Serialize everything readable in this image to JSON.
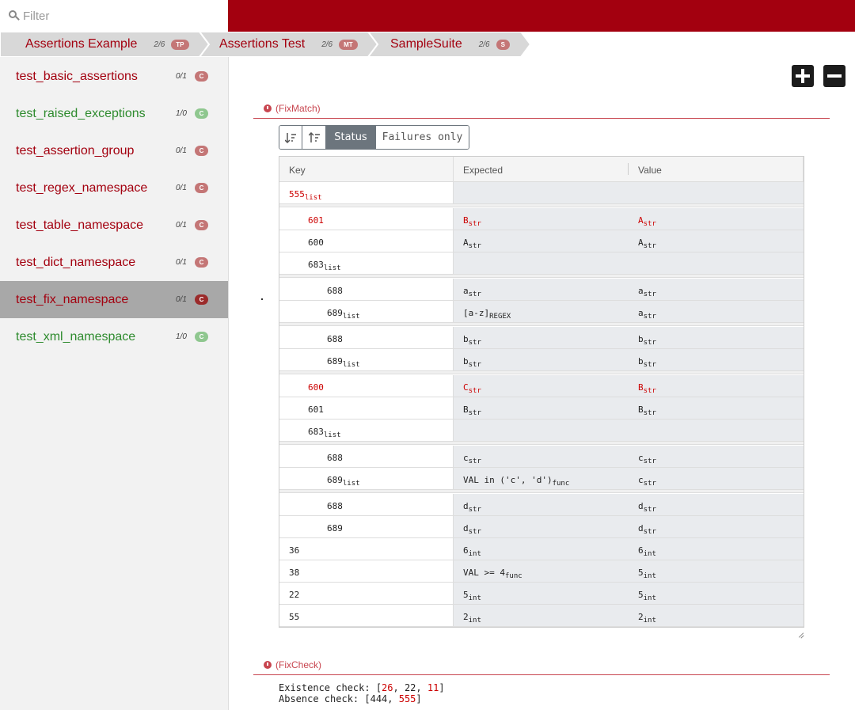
{
  "filter": {
    "placeholder": "Filter"
  },
  "breadcrumbs": [
    {
      "label": "Assertions Example",
      "count": "2/6",
      "badge": "TP"
    },
    {
      "label": "Assertions Test",
      "count": "2/6",
      "badge": "MT"
    },
    {
      "label": "SampleSuite",
      "count": "2/6",
      "badge": "S"
    }
  ],
  "sidebar": {
    "items": [
      {
        "name": "test_basic_assertions",
        "count": "0/1",
        "badge": "C",
        "status": "fail"
      },
      {
        "name": "test_raised_exceptions",
        "count": "1/0",
        "badge": "C",
        "status": "pass"
      },
      {
        "name": "test_assertion_group",
        "count": "0/1",
        "badge": "C",
        "status": "fail"
      },
      {
        "name": "test_regex_namespace",
        "count": "0/1",
        "badge": "C",
        "status": "fail"
      },
      {
        "name": "test_table_namespace",
        "count": "0/1",
        "badge": "C",
        "status": "fail"
      },
      {
        "name": "test_dict_namespace",
        "count": "0/1",
        "badge": "C",
        "status": "fail"
      },
      {
        "name": "test_fix_namespace",
        "count": "0/1",
        "badge": "C",
        "status": "active"
      },
      {
        "name": "test_xml_namespace",
        "count": "1/0",
        "badge": "C",
        "status": "pass"
      }
    ]
  },
  "toolbar": {
    "expand_icon": "plus-icon",
    "collapse_icon": "minus-icon"
  },
  "fixmatch": {
    "title": "(FixMatch)",
    "buttons": {
      "sort_desc_icon": "sort-descending-icon",
      "sort_asc_icon": "sort-ascending-icon",
      "status": "Status",
      "failures_only": "Failures only"
    },
    "columns": {
      "key": "Key",
      "expected": "Expected",
      "value": "Value"
    },
    "rows": [
      {
        "key": "555",
        "key_type": "list",
        "expected": "",
        "expected_type": "",
        "value": "",
        "value_type": "",
        "indent": 0,
        "failed": true
      },
      {
        "key": "601",
        "key_type": "",
        "expected": "B",
        "expected_type": "str",
        "value": "A",
        "value_type": "str",
        "indent": 1,
        "failed": true
      },
      {
        "key": "600",
        "key_type": "",
        "expected": "A",
        "expected_type": "str",
        "value": "A",
        "value_type": "str",
        "indent": 1,
        "failed": false
      },
      {
        "key": "683",
        "key_type": "list",
        "expected": "",
        "expected_type": "",
        "value": "",
        "value_type": "",
        "indent": 1,
        "failed": false
      },
      {
        "key": "688",
        "key_type": "",
        "expected": "a",
        "expected_type": "str",
        "value": "a",
        "value_type": "str",
        "indent": 2,
        "failed": false
      },
      {
        "key": "689",
        "key_type": "list",
        "expected": "[a-z]",
        "expected_type": "REGEX",
        "value": "a",
        "value_type": "str",
        "indent": 2,
        "failed": false
      },
      {
        "key": "688",
        "key_type": "",
        "expected": "b",
        "expected_type": "str",
        "value": "b",
        "value_type": "str",
        "indent": 2,
        "failed": false
      },
      {
        "key": "689",
        "key_type": "list",
        "expected": "b",
        "expected_type": "str",
        "value": "b",
        "value_type": "str",
        "indent": 2,
        "failed": false
      },
      {
        "key": "600",
        "key_type": "",
        "expected": "C",
        "expected_type": "str",
        "value": "B",
        "value_type": "str",
        "indent": 1,
        "failed": true
      },
      {
        "key": "601",
        "key_type": "",
        "expected": "B",
        "expected_type": "str",
        "value": "B",
        "value_type": "str",
        "indent": 1,
        "failed": false
      },
      {
        "key": "683",
        "key_type": "list",
        "expected": "",
        "expected_type": "",
        "value": "",
        "value_type": "",
        "indent": 1,
        "failed": false
      },
      {
        "key": "688",
        "key_type": "",
        "expected": "c",
        "expected_type": "str",
        "value": "c",
        "value_type": "str",
        "indent": 2,
        "failed": false
      },
      {
        "key": "689",
        "key_type": "list",
        "expected": "VAL in ('c', 'd')",
        "expected_type": "func",
        "value": "c",
        "value_type": "str",
        "indent": 2,
        "failed": false
      },
      {
        "key": "688",
        "key_type": "",
        "expected": "d",
        "expected_type": "str",
        "value": "d",
        "value_type": "str",
        "indent": 2,
        "failed": false
      },
      {
        "key": "689",
        "key_type": "",
        "expected": "d",
        "expected_type": "str",
        "value": "d",
        "value_type": "str",
        "indent": 2,
        "failed": false
      },
      {
        "key": "36",
        "key_type": "",
        "expected": "6",
        "expected_type": "int",
        "value": "6",
        "value_type": "int",
        "indent": 0,
        "failed": false
      },
      {
        "key": "38",
        "key_type": "",
        "expected": "VAL >= 4",
        "expected_type": "func",
        "value": "5",
        "value_type": "int",
        "indent": 0,
        "failed": false
      },
      {
        "key": "22",
        "key_type": "",
        "expected": "5",
        "expected_type": "int",
        "value": "5",
        "value_type": "int",
        "indent": 0,
        "failed": false
      },
      {
        "key": "55",
        "key_type": "",
        "expected": "2",
        "expected_type": "int",
        "value": "2",
        "value_type": "int",
        "indent": 0,
        "failed": false
      }
    ]
  },
  "fixcheck": {
    "title": "(FixCheck)",
    "existence_label": "Existence check: [",
    "existence_values": [
      {
        "text": "26",
        "failed": true
      },
      {
        "text": "22",
        "failed": false
      },
      {
        "text": "11",
        "failed": true
      }
    ],
    "absence_label": "Absence check: [",
    "absence_values": [
      {
        "text": "444",
        "failed": false
      },
      {
        "text": "555",
        "failed": true
      }
    ]
  },
  "colors": {
    "brand": "#a3000f",
    "fail": "#cc0000",
    "pass": "#2e8b2e",
    "section": "#c8454f"
  }
}
